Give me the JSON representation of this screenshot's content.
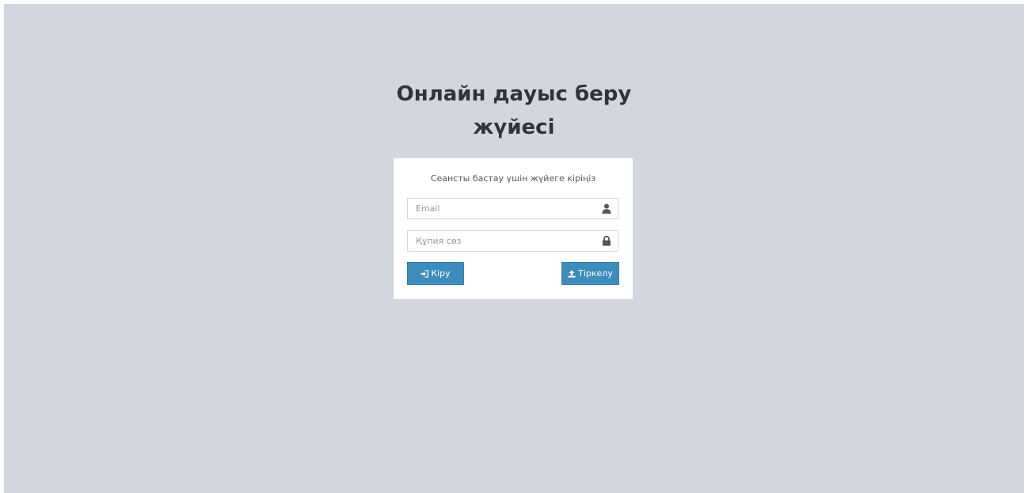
{
  "page": {
    "title_line1": "Онлайн дауыс беру",
    "title_line2": "жүйесі"
  },
  "login": {
    "message": "Сеансты бастау үшін жүйеге кіріңіз",
    "email_placeholder": "Email",
    "email_value": "",
    "email_icon": "user-icon",
    "password_placeholder": "Құпия сөз",
    "password_value": "",
    "password_icon": "lock-icon",
    "login_button": "Кіру",
    "login_icon": "sign-in-icon",
    "register_button": "Тіркелу",
    "register_icon": "upload-icon"
  },
  "colors": {
    "background": "#d2d6de",
    "panel": "#ffffff",
    "primary": "#3c8dbc",
    "title": "#333333"
  }
}
